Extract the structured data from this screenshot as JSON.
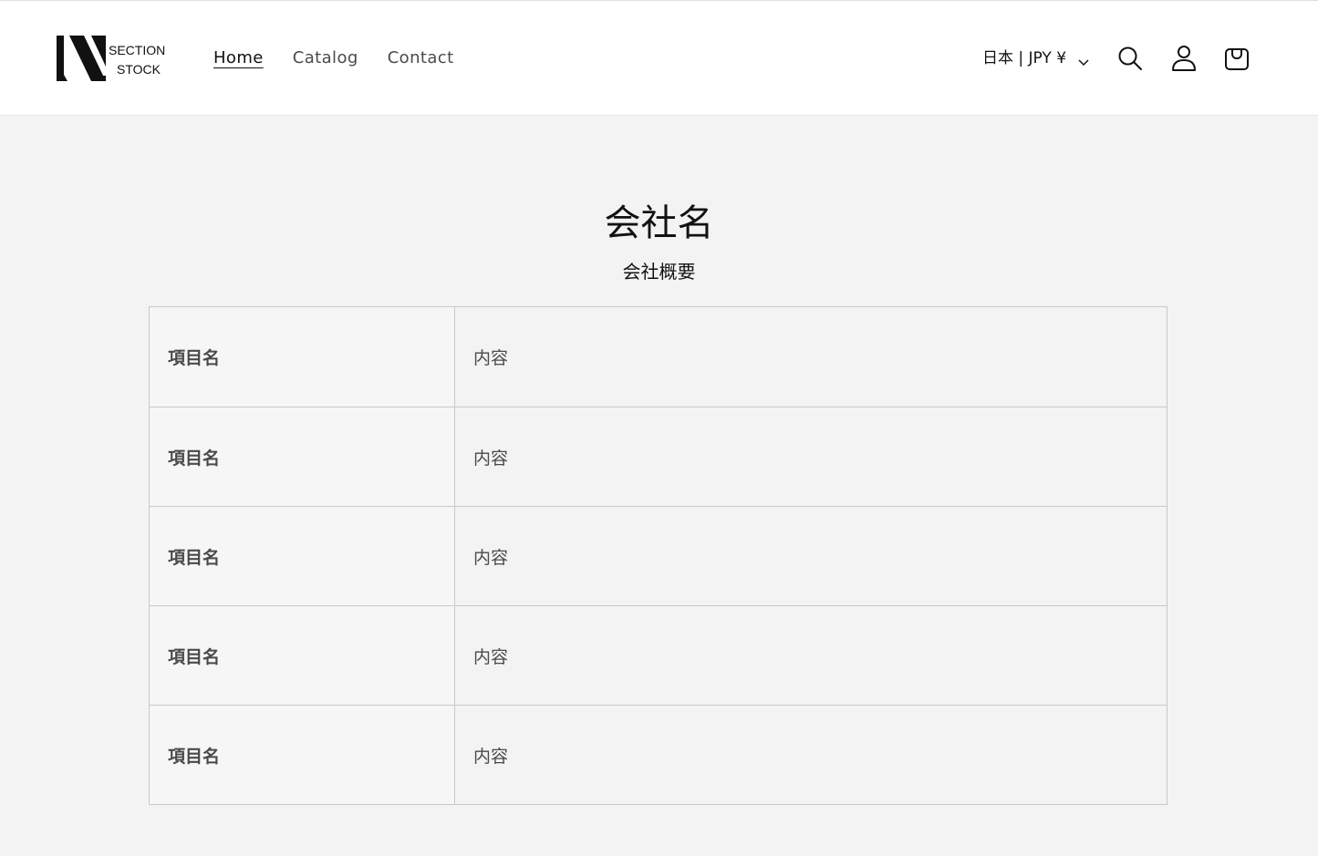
{
  "header": {
    "logo": {
      "line1": "SECTION",
      "line2": "STOCK"
    },
    "nav": [
      {
        "label": "Home",
        "active": true
      },
      {
        "label": "Catalog",
        "active": false
      },
      {
        "label": "Contact",
        "active": false
      }
    ],
    "country_selector": "日本 | JPY ¥",
    "icons": [
      "search-icon",
      "account-icon",
      "cart-icon"
    ]
  },
  "main": {
    "title": "会社名",
    "subtitle": "会社概要",
    "rows": [
      {
        "label": "項目名",
        "value": "内容"
      },
      {
        "label": "項目名",
        "value": "内容"
      },
      {
        "label": "項目名",
        "value": "内容"
      },
      {
        "label": "項目名",
        "value": "内容"
      },
      {
        "label": "項目名",
        "value": "内容"
      }
    ]
  },
  "colors": {
    "header_bg": "#ffffff",
    "main_bg": "#f3f3f3",
    "text": "#121212",
    "border": "#c9c9c9"
  }
}
